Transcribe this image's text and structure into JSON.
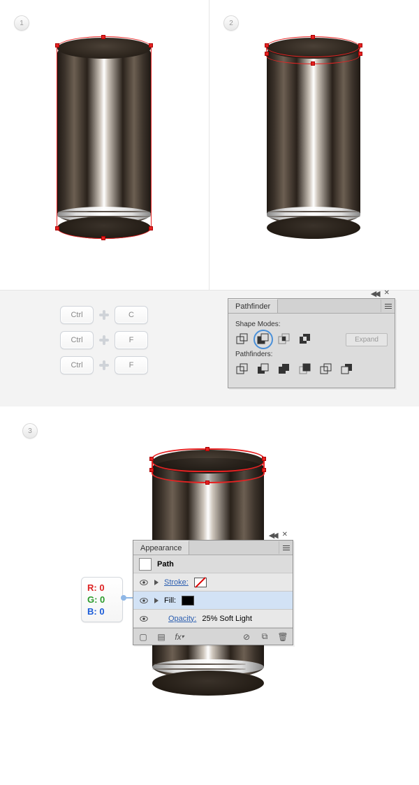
{
  "steps": {
    "one": "1",
    "two": "2",
    "three": "3"
  },
  "shortcuts": {
    "rows": [
      {
        "mod": "Ctrl",
        "key": "C"
      },
      {
        "mod": "Ctrl",
        "key": "F"
      },
      {
        "mod": "Ctrl",
        "key": "F"
      }
    ]
  },
  "pathfinder": {
    "title": "Pathfinder",
    "shape_modes_label": "Shape Modes:",
    "pathfinders_label": "Pathfinders:",
    "expand_label": "Expand",
    "shape_mode_icons": [
      "unite",
      "minus-front",
      "intersect",
      "exclude"
    ],
    "pathfinder_icons": [
      "divide",
      "trim",
      "merge",
      "crop",
      "outline",
      "minus-back"
    ],
    "selected_shape_mode": "minus-front"
  },
  "appearance": {
    "title": "Appearance",
    "object_label": "Path",
    "stroke_label": "Stroke:",
    "fill_label": "Fill:",
    "opacity_label": "Opacity:",
    "opacity_value": "25% Soft Light",
    "footer_fx": "fx"
  },
  "rgb_callout": {
    "r": "R: 0",
    "g": "G: 0",
    "b": "B: 0"
  }
}
